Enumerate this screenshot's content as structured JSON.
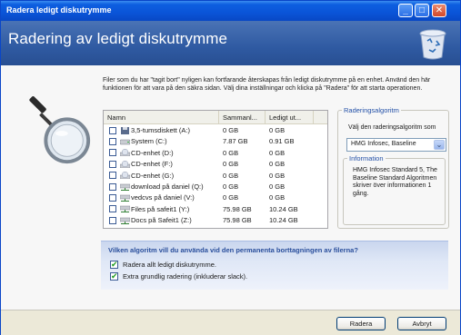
{
  "window": {
    "title": "Radera ledigt diskutrymme",
    "controls": {
      "minimize": "_",
      "maximize": "□",
      "close": "✕"
    }
  },
  "header": {
    "title": "Radering av ledigt diskutrymme"
  },
  "intro": {
    "text": "Filer som du har \"tagit bort\" nyligen kan fortfarande återskapas från ledigt diskutrymme på en enhet. Använd den här funktionen för att vara på den säkra sidan. Välj dina inställningar och klicka på \"Radera\" för att starta operationen."
  },
  "drive_list": {
    "columns": [
      "Namn",
      "Sammanl...",
      "Ledigt ut..."
    ],
    "rows": [
      {
        "icon": "floppy-drive-icon",
        "name": "3,5-tumsdiskett (A:)",
        "total": "0 GB",
        "free": "0 GB",
        "checked": false
      },
      {
        "icon": "hard-drive-icon",
        "name": "System (C:)",
        "total": "7.87 GB",
        "free": "0.91 GB",
        "checked": false
      },
      {
        "icon": "cd-drive-icon",
        "name": "CD-enhet (D:)",
        "total": "0 GB",
        "free": "0 GB",
        "checked": false
      },
      {
        "icon": "cd-drive-icon",
        "name": "CD-enhet (F:)",
        "total": "0 GB",
        "free": "0 GB",
        "checked": false
      },
      {
        "icon": "cd-drive-icon",
        "name": "CD-enhet (G:)",
        "total": "0 GB",
        "free": "0 GB",
        "checked": false
      },
      {
        "icon": "network-drive-icon",
        "name": "download på daniel (Q:)",
        "total": "0 GB",
        "free": "0 GB",
        "checked": false
      },
      {
        "icon": "network-drive-icon",
        "name": "vedcvs på daniel (V:)",
        "total": "0 GB",
        "free": "0 GB",
        "checked": false
      },
      {
        "icon": "network-drive-icon",
        "name": "Files på safeit1 (Y:)",
        "total": "75.98 GB",
        "free": "10.24 GB",
        "checked": false
      },
      {
        "icon": "network-drive-icon",
        "name": "Docs på Safeit1 (Z:)",
        "total": "75.98 GB",
        "free": "10.24 GB",
        "checked": false
      }
    ]
  },
  "algorithm": {
    "group_label": "Raderingsalgoritm",
    "prompt": "Välj den raderingsalgoritm som",
    "selected": "HMG Infosec, Baseline",
    "info_label": "Information",
    "info_text": "HMG Infosec Standard 5, The Baseline Standard Algoritmen skriver över informationen 1 gång."
  },
  "options": {
    "title": "Vilken algoritm vill du använda vid den permanenta borttagningen av filerna?",
    "items": [
      {
        "label": "Radera allt ledigt diskutrymme.",
        "checked": true
      },
      {
        "label": "Extra grundlig radering (inkluderar slack).",
        "checked": true
      }
    ],
    "check_glyph": "✔"
  },
  "footer": {
    "ok_label": "Radera",
    "cancel_label": "Avbryt"
  },
  "colors": {
    "title_bar": "#0a54d8",
    "header_band": "#2f5aa2",
    "group_label": "#2350a7"
  }
}
